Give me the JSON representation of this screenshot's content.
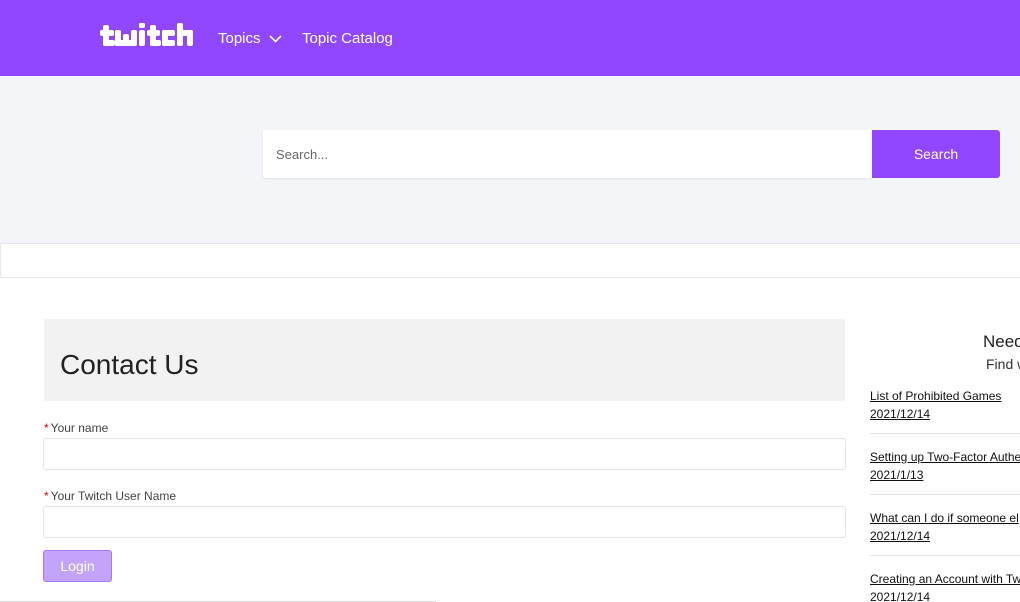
{
  "header": {
    "logo_text": "twitch",
    "nav": [
      {
        "label": "Topics"
      },
      {
        "label": "Topic Catalog"
      }
    ],
    "color": "#9146ff"
  },
  "search": {
    "placeholder": "Search...",
    "button_label": "Search"
  },
  "contact": {
    "title": "Contact Us",
    "fields": [
      {
        "label": "Your name",
        "required_mark": "*",
        "value": ""
      },
      {
        "label": "Your Twitch User Name",
        "required_mark": "*",
        "value": ""
      }
    ],
    "login_label": "Login"
  },
  "sidebar": {
    "heading": "Need",
    "subheading": "Find w",
    "articles": [
      {
        "title": "List of Prohibited Games",
        "date": "2021/12/14"
      },
      {
        "title": "Setting up Two-Factor Authe",
        "date": "2021/1/13"
      },
      {
        "title": "What can I do if someone el",
        "date": "2021/12/14"
      },
      {
        "title": "Creating an Account with Tw",
        "date": "2021/12/14"
      }
    ]
  }
}
